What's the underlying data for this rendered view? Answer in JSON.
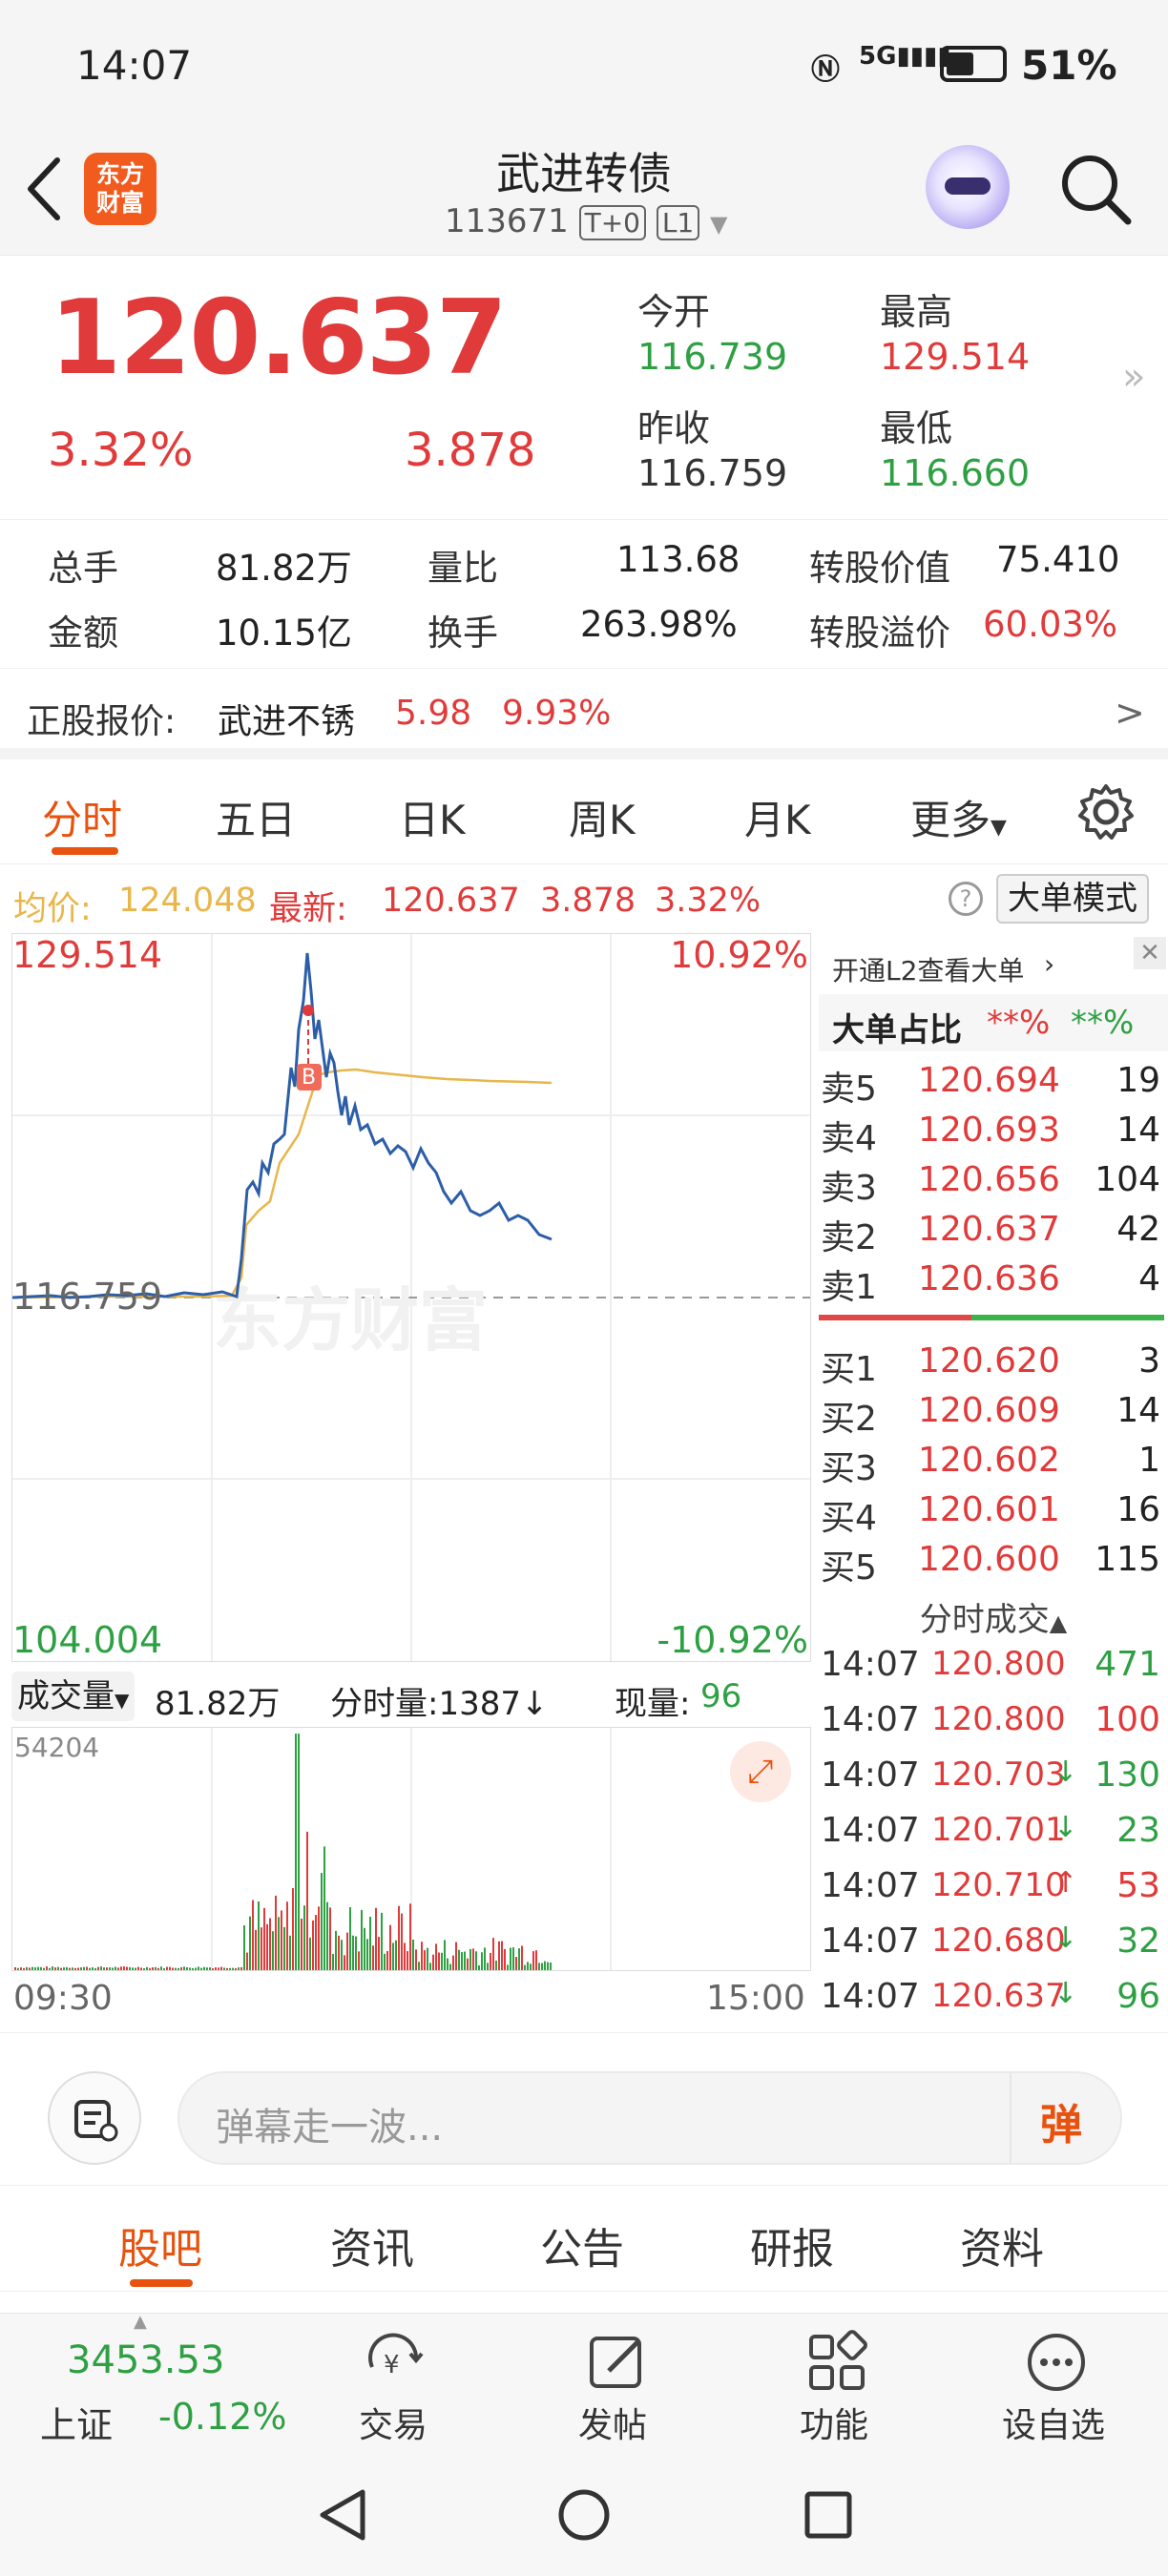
{
  "status": {
    "time": "14:07",
    "battery": "51%",
    "signal": "5G"
  },
  "header": {
    "title": "武进转债",
    "code": "113671",
    "badge1": "T+0",
    "badge2": "L1",
    "logo_line1": "东方",
    "logo_line2": "财富"
  },
  "quote": {
    "price": "120.637",
    "pct": "3.32%",
    "change": "3.878",
    "open_label": "今开",
    "open": "116.739",
    "high_label": "最高",
    "high": "129.514",
    "prev_label": "昨收",
    "prev": "116.759",
    "low_label": "最低",
    "low": "116.660"
  },
  "stats": {
    "vol_label": "总手",
    "vol": "81.82万",
    "ratio_label": "量比",
    "ratio": "113.68",
    "cv_label": "转股价值",
    "cv": "75.410",
    "amt_label": "金额",
    "amt": "10.15亿",
    "turn_label": "换手",
    "turn": "263.98%",
    "prem_label": "转股溢价",
    "prem": "60.03%"
  },
  "underlying": {
    "label": "正股报价:",
    "name": "武进不锈",
    "price": "5.98",
    "pct": "9.93%"
  },
  "tabs": [
    "分时",
    "五日",
    "日K",
    "周K",
    "月K",
    "更多"
  ],
  "infoline": {
    "avg_label": "均价:",
    "avg": "124.048",
    "last_label": "最新:",
    "last": "120.637",
    "chg": "3.878",
    "pct": "3.32%",
    "mode": "大单模式"
  },
  "chart": {
    "ymax": "129.514",
    "ymax_pct": "10.92%",
    "ymid": "116.759",
    "ymin": "104.004",
    "ymin_pct": "-10.92%",
    "watermark": "东方财富",
    "marker": "B"
  },
  "volume": {
    "label": "成交量",
    "total": "81.82万",
    "tick_label": "分时量:",
    "tick": "1387",
    "now_label": "现量:",
    "now": "96",
    "max": "54204",
    "start": "09:30",
    "end": "15:00"
  },
  "orderbook": {
    "l2_link": "开通L2查看大单",
    "big_label": "大单占比",
    "big_buy": "**%",
    "big_sell": "**%",
    "asks": [
      {
        "label": "卖5",
        "price": "120.694",
        "qty": "19"
      },
      {
        "label": "卖4",
        "price": "120.693",
        "qty": "14"
      },
      {
        "label": "卖3",
        "price": "120.656",
        "qty": "104"
      },
      {
        "label": "卖2",
        "price": "120.637",
        "qty": "42"
      },
      {
        "label": "卖1",
        "price": "120.636",
        "qty": "4"
      }
    ],
    "bids": [
      {
        "label": "买1",
        "price": "120.620",
        "qty": "3"
      },
      {
        "label": "买2",
        "price": "120.609",
        "qty": "14"
      },
      {
        "label": "买3",
        "price": "120.602",
        "qty": "1"
      },
      {
        "label": "买4",
        "price": "120.601",
        "qty": "16"
      },
      {
        "label": "买5",
        "price": "120.600",
        "qty": "115"
      }
    ],
    "trades_label": "分时成交",
    "trades": [
      {
        "time": "14:07",
        "price": "120.800",
        "arrow": "",
        "qty": "471",
        "qcolor": "#2ea043"
      },
      {
        "time": "14:07",
        "price": "120.800",
        "arrow": "",
        "qty": "100",
        "qcolor": "#e03a3a"
      },
      {
        "time": "14:07",
        "price": "120.703",
        "arrow": "↓",
        "qty": "130",
        "qcolor": "#2ea043"
      },
      {
        "time": "14:07",
        "price": "120.701",
        "arrow": "↓",
        "qty": "23",
        "qcolor": "#2ea043"
      },
      {
        "time": "14:07",
        "price": "120.710",
        "arrow": "↑",
        "qty": "53",
        "qcolor": "#e03a3a"
      },
      {
        "time": "14:07",
        "price": "120.680",
        "arrow": "↓",
        "qty": "32",
        "qcolor": "#2ea043"
      },
      {
        "time": "14:07",
        "price": "120.637",
        "arrow": "↓",
        "qty": "96",
        "qcolor": "#2ea043"
      }
    ]
  },
  "danmu": {
    "placeholder": "弹幕走一波...",
    "btn": "弹"
  },
  "subtabs": [
    "股吧",
    "资讯",
    "公告",
    "研报",
    "资料"
  ],
  "bottom": {
    "index_value": "3453.53",
    "index_name": "上证",
    "index_pct": "-0.12%",
    "items": [
      "交易",
      "发帖",
      "功能",
      "设自选"
    ]
  },
  "colors": {
    "up": "#e03a3a",
    "down": "#2ea043",
    "accent": "#e8520f",
    "price_line": "#2c5ea8",
    "avg_line": "#e8b64a"
  }
}
